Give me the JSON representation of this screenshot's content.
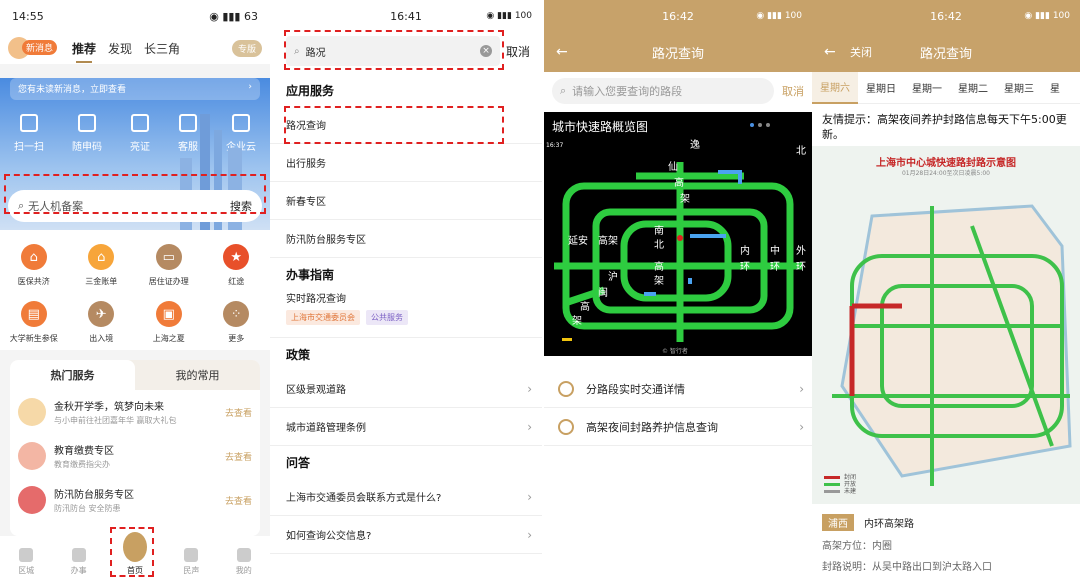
{
  "panel1": {
    "time": "14:55",
    "battery": "63",
    "new_msg": "新消息",
    "tabs": [
      "推荐",
      "发现",
      "长三角"
    ],
    "pill": "专版",
    "notice": "您有未读新消息，立即查看",
    "quick": [
      "扫一扫",
      "随申码",
      "亮证",
      "客服",
      "企业云"
    ],
    "search_placeholder": "无人机备案",
    "search_btn": "搜索",
    "services": [
      {
        "label": "医保共济",
        "color": "#f07b39"
      },
      {
        "label": "三金账单",
        "color": "#f7a53a"
      },
      {
        "label": "居住证办理",
        "color": "#b58a62"
      },
      {
        "label": "红途",
        "color": "#e8502a"
      },
      {
        "label": "大学新生参保",
        "color": "#f07b39"
      },
      {
        "label": "出入境",
        "color": "#b58a62"
      },
      {
        "label": "上海之夏",
        "color": "#f07b39"
      },
      {
        "label": "更多",
        "color": "#b58a62"
      }
    ],
    "hot_tabs": [
      "热门服务",
      "我的常用"
    ],
    "hot_items": [
      {
        "title": "金秋开学季，筑梦向未来",
        "sub": "与小申前往社团嘉年华 赢取大礼包",
        "go": "去查看",
        "color": "#f6d9a8"
      },
      {
        "title": "教育缴费专区",
        "sub": "教育缴费指尖办",
        "go": "去查看",
        "color": "#f3b6a4"
      },
      {
        "title": "防汛防台服务专区",
        "sub": "防汛防台 安全防患",
        "go": "去查看",
        "color": "#e56b6b"
      }
    ],
    "tabbar": [
      "区城",
      "办事",
      "首页",
      "民声",
      "我的"
    ]
  },
  "panel2": {
    "time": "16:41",
    "battery": "100",
    "search_value": "路况",
    "cancel": "取消",
    "sec1": "应用服务",
    "app_items": [
      "路况查询",
      "出行服务",
      "新春专区",
      "防汛防台服务专区"
    ],
    "sec2": "办事指南",
    "guide_title": "实时路况查询",
    "guide_tags": [
      "上海市交通委员会",
      "公共服务"
    ],
    "sec3": "政策",
    "policy_items": [
      "区级景观道路",
      "城市道路管理条例"
    ],
    "sec4": "问答",
    "qa_items": [
      "上海市交通委员会联系方式是什么?",
      "如何查询公交信息?"
    ]
  },
  "panel3": {
    "time": "16:42",
    "battery": "100",
    "title": "路况查询",
    "search_placeholder": "请输入您要查询的路段",
    "cancel": "取消",
    "map_title": "城市快速路概览图",
    "map_time": "16:37",
    "map_labels": [
      "逸",
      "仙",
      "高",
      "架",
      "延安",
      "高架",
      "南",
      "北",
      "高",
      "架",
      "内",
      "环",
      "中",
      "环",
      "外",
      "环",
      "沪",
      "闽",
      "高",
      "架",
      "北"
    ],
    "map_copyright": "© 智行者",
    "rows": [
      "分路段实时交通详情",
      "高架夜间封路养护信息查询"
    ]
  },
  "panel4": {
    "time": "16:42",
    "battery": "100",
    "close": "关闭",
    "title": "路况查询",
    "days": [
      "星期六",
      "星期日",
      "星期一",
      "星期二",
      "星期三",
      "星"
    ],
    "tip": "友情提示：高架夜间养护封路信息每天下午5:00更新。",
    "map_title": "上海市中心城快速路封路示意图",
    "map_sub": "01月28日24:00至次日凌晨5:00",
    "legend": [
      "封闭",
      "开放",
      "未建"
    ],
    "route_badge": "浦西",
    "route_name": "内环高架路",
    "dir_label": "高架方位：",
    "dir_value": "内圈",
    "desc_label": "封路说明：",
    "desc_value": "从吴中路出口到沪太路入口"
  }
}
